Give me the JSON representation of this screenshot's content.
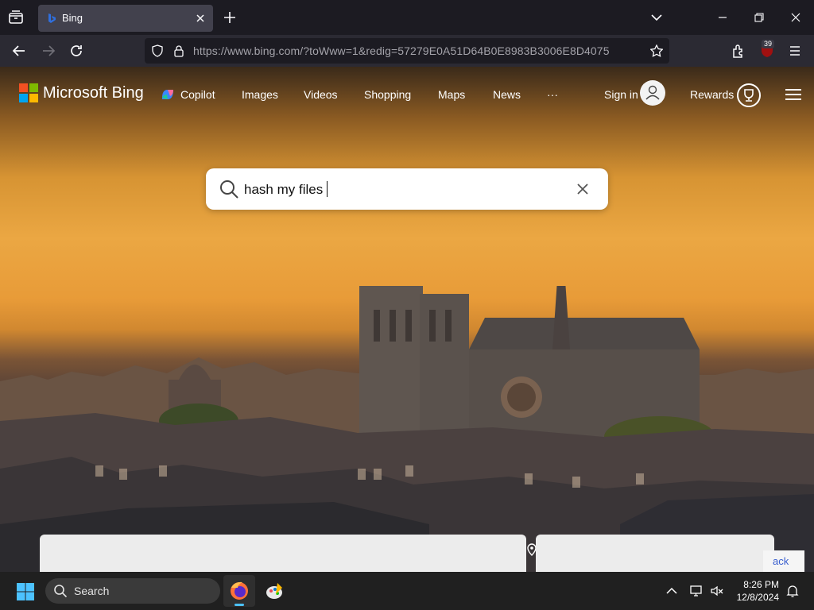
{
  "browser": {
    "tab_title": "Bing",
    "url": "https://www.bing.com/?toWww=1&redig=57279E0A51D64B0E8983B3006E8D4075",
    "extension_badge": "39"
  },
  "bing": {
    "brand": "Microsoft Bing",
    "nav": [
      "Copilot",
      "Images",
      "Videos",
      "Shopping",
      "Maps",
      "News",
      "···"
    ],
    "sign_in": "Sign in",
    "rewards": "Rewards",
    "search_query": "hash my files",
    "feedback_partial": "ack"
  },
  "taskbar": {
    "search_placeholder": "Search",
    "time": "8:26 PM",
    "date": "12/8/2024"
  },
  "colors": {
    "browser_dark": "#1c1b22",
    "toolbar": "#2b2a33",
    "tab_active": "#42414d",
    "accent_blue": "#4cc2ff",
    "taskbar": "#202020"
  },
  "icons": [
    "tab-list-icon",
    "bing-favicon",
    "close-icon",
    "plus-icon",
    "chevron-down-icon",
    "minimize-icon",
    "maximize-icon",
    "back-arrow-icon",
    "forward-arrow-icon",
    "reload-icon",
    "shield-icon",
    "lock-icon",
    "bookmark-star-icon",
    "extensions-icon",
    "menu-icon",
    "microsoft-logo-icon",
    "copilot-icon",
    "user-icon",
    "rewards-trophy-icon",
    "hamburger-icon",
    "search-icon",
    "location-pin-icon",
    "windows-start-icon",
    "firefox-icon",
    "paint-app-icon",
    "chevron-up-icon",
    "network-icon",
    "volume-muted-icon",
    "notification-bell-icon"
  ]
}
